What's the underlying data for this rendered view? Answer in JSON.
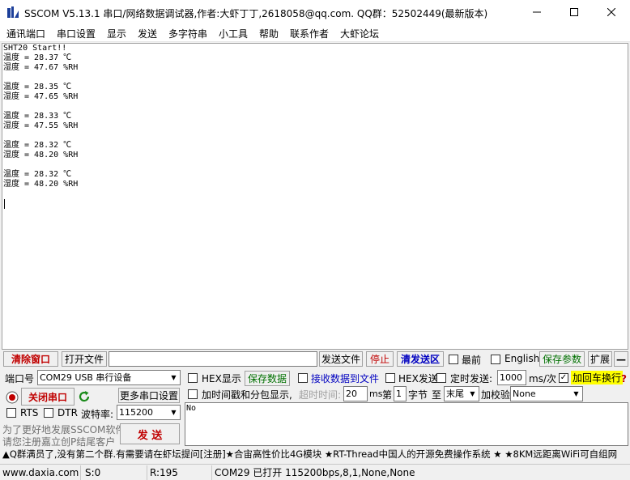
{
  "window": {
    "title": "SSCOM V5.13.1 串口/网络数据调试器,作者:大虾丁丁,2618058@qq.com. QQ群：52502449(最新版本)"
  },
  "menu": [
    "通讯端口",
    "串口设置",
    "显示",
    "发送",
    "多字符串",
    "小工具",
    "帮助",
    "联系作者",
    "大虾论坛"
  ],
  "receive": {
    "lines": [
      "SHT20 Start!!",
      "温度 = 28.37 ℃",
      "湿度 = 47.67 %RH",
      "",
      "温度 = 28.35 ℃",
      "湿度 = 47.65 %RH",
      "",
      "温度 = 28.33 ℃",
      "湿度 = 47.55 %RH",
      "",
      "温度 = 28.32 ℃",
      "湿度 = 48.20 %RH",
      "",
      "温度 = 28.32 ℃",
      "湿度 = 48.20 %RH"
    ]
  },
  "toolbar": {
    "clear_window": "清除窗口",
    "open_file": "打开文件",
    "file_path": "",
    "send_file": "发送文件",
    "stop": "停止",
    "clear_send_area": "清发送区",
    "topmost": "最前",
    "english": "English",
    "save_params": "保存参数",
    "expand": "扩展",
    "minus": "—"
  },
  "port": {
    "port_label": "端口号",
    "port_value": "COM29 USB 串行设备",
    "close_port": "关闭串口",
    "more_settings": "更多串口设置",
    "rts": "RTS",
    "dtr": "DTR",
    "baud_label": "波特率:",
    "baud_value": "115200"
  },
  "options": {
    "hex_display": "HEX显示",
    "save_data": "保存数据",
    "recv_to_file": "接收数据到文件",
    "hex_send": "HEX发送",
    "timed_send": "定时发送:",
    "interval_value": "1000",
    "interval_unit": "ms/次",
    "add_crlf": "加回车换行",
    "timestamp": "加时间戳和分包显示,",
    "timeout_label": "超时时间:",
    "timeout_value": "20",
    "timeout_unit": "ms",
    "byte_prefix": "第",
    "byte_value": "1",
    "byte_label": "字节",
    "to_label": "至",
    "end_value": "末尾",
    "checksum_label": "加校验",
    "checksum_value": "None"
  },
  "promo": {
    "line1": "为了更好地发展SSCOM软件",
    "line2": "请您注册嘉立创P结尾客户"
  },
  "send": {
    "button": "发 送",
    "text": "No"
  },
  "marquee": "▲Q群满员了,没有第二个群.有需要请在虾坛提问[注册]★合宙高性价比4G模块 ★RT-Thread中国人的开源免费操作系统 ★ ★8KM远距离WiFi可自组网",
  "statusbar": {
    "website": "www.daxia.com",
    "sent": "S:0",
    "received": "R:195",
    "status": "COM29 已打开  115200bps,8,1,None,None"
  },
  "colors": {
    "red_button": "#c00000",
    "green_button": "#007000",
    "blue_button": "#0000c0",
    "crlf_highlight": "#ffff00"
  }
}
